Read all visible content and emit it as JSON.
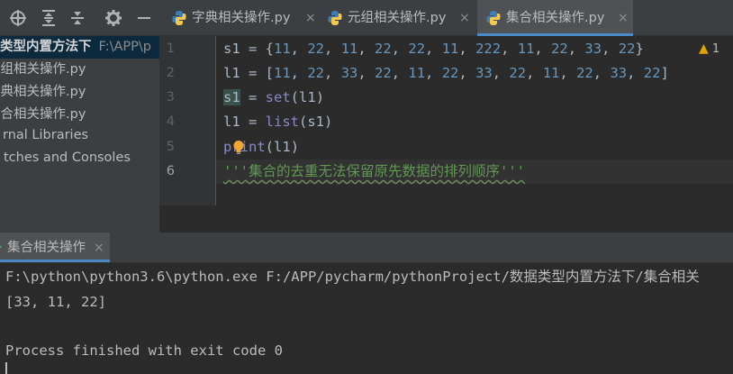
{
  "project_toolbar": {
    "icons": [
      "target-icon",
      "expand-all-icon",
      "collapse-all-icon",
      "gear-icon",
      "minimize-icon"
    ]
  },
  "project_tree": {
    "selected_folder": "类型内置方法下",
    "selected_folder_path": "F:\\APP\\p",
    "items": [
      {
        "label": "元组相关操作.py"
      },
      {
        "label": "字典相关操作.py"
      },
      {
        "label": "集合相关操作.py"
      },
      {
        "label": "rnal Libraries"
      },
      {
        "label": "tches and Consoles"
      }
    ]
  },
  "editor_tabs": [
    {
      "label": "字典相关操作.py",
      "close": "×",
      "active": false
    },
    {
      "label": "元组相关操作.py",
      "close": "×",
      "active": false
    },
    {
      "label": "集合相关操作.py",
      "close": "×",
      "active": true
    }
  ],
  "editor": {
    "line_numbers": [
      "1",
      "2",
      "3",
      "4",
      "5",
      "6"
    ],
    "lines": [
      "s1 = {11, 22, 11, 22, 22, 11, 222, 11, 22, 33, 22}",
      "l1 = [11, 22, 33, 22, 11, 22, 33, 22, 11, 22, 33, 22]",
      "s1 = set(l1)",
      "l1 = list(s1)",
      "print(l1)",
      "'''集合的去重无法保留原先数据的排列顺序'''"
    ],
    "warning_count": "1"
  },
  "run_panel": {
    "tab_label": "集合相关操作",
    "tab_close": "×",
    "console_lines": [
      "F:\\python\\python3.6\\python.exe F:/APP/pycharm/pythonProject/数据类型内置方法下/集合相关",
      "[33, 11, 22]",
      "",
      "Process finished with exit code 0"
    ]
  },
  "colors": {
    "accent": "#4a88c7",
    "number": "#6897bb",
    "builtin": "#8888c6",
    "docstring": "#629755",
    "warning": "#e5a100"
  }
}
